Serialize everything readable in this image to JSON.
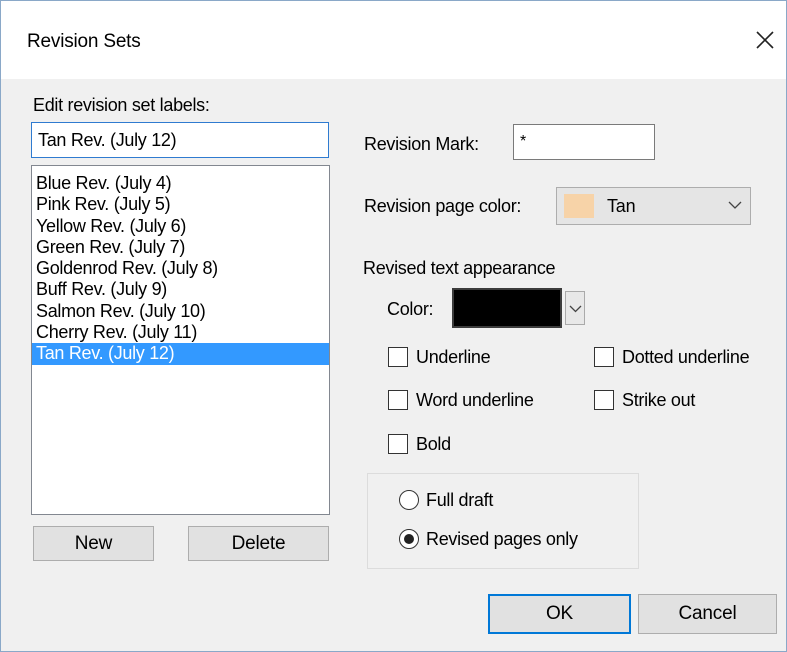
{
  "window": {
    "title": "Revision Sets",
    "close_glyph": "close-icon"
  },
  "labels_section": {
    "heading": "Edit revision set labels:",
    "current_value": "Tan Rev. (July 12)",
    "items": [
      "Blue Rev. (July 4)",
      "Pink Rev. (July 5)",
      "Yellow Rev. (July 6)",
      "Green Rev. (July 7)",
      "Goldenrod Rev. (July 8)",
      "Buff Rev. (July 9)",
      "Salmon Rev. (July 10)",
      "Cherry Rev. (July 11)",
      "Tan Rev. (July 12)"
    ],
    "selected_index": 8,
    "new_button": "New",
    "delete_button": "Delete"
  },
  "revision_mark": {
    "label": "Revision Mark:",
    "value": "*"
  },
  "page_color": {
    "label": "Revision page color:",
    "selected": "Tan",
    "swatch_color": "#f7d3a8"
  },
  "appearance": {
    "heading": "Revised text appearance",
    "color_label": "Color:",
    "color_value": "#000000",
    "underline": "Underline",
    "dotted_underline": "Dotted underline",
    "word_underline": "Word underline",
    "strike_out": "Strike out",
    "bold": "Bold",
    "checked": {
      "underline": false,
      "dotted_underline": false,
      "word_underline": false,
      "strike_out": false,
      "bold": false
    }
  },
  "scope": {
    "full_draft": "Full draft",
    "revised_pages_only": "Revised pages only",
    "selected": "revised_pages_only"
  },
  "buttons": {
    "ok": "OK",
    "cancel": "Cancel"
  },
  "colors": {
    "selection": "#3399ff",
    "focus_border": "#0078d7",
    "dialog_bg": "#f0f0f0"
  }
}
